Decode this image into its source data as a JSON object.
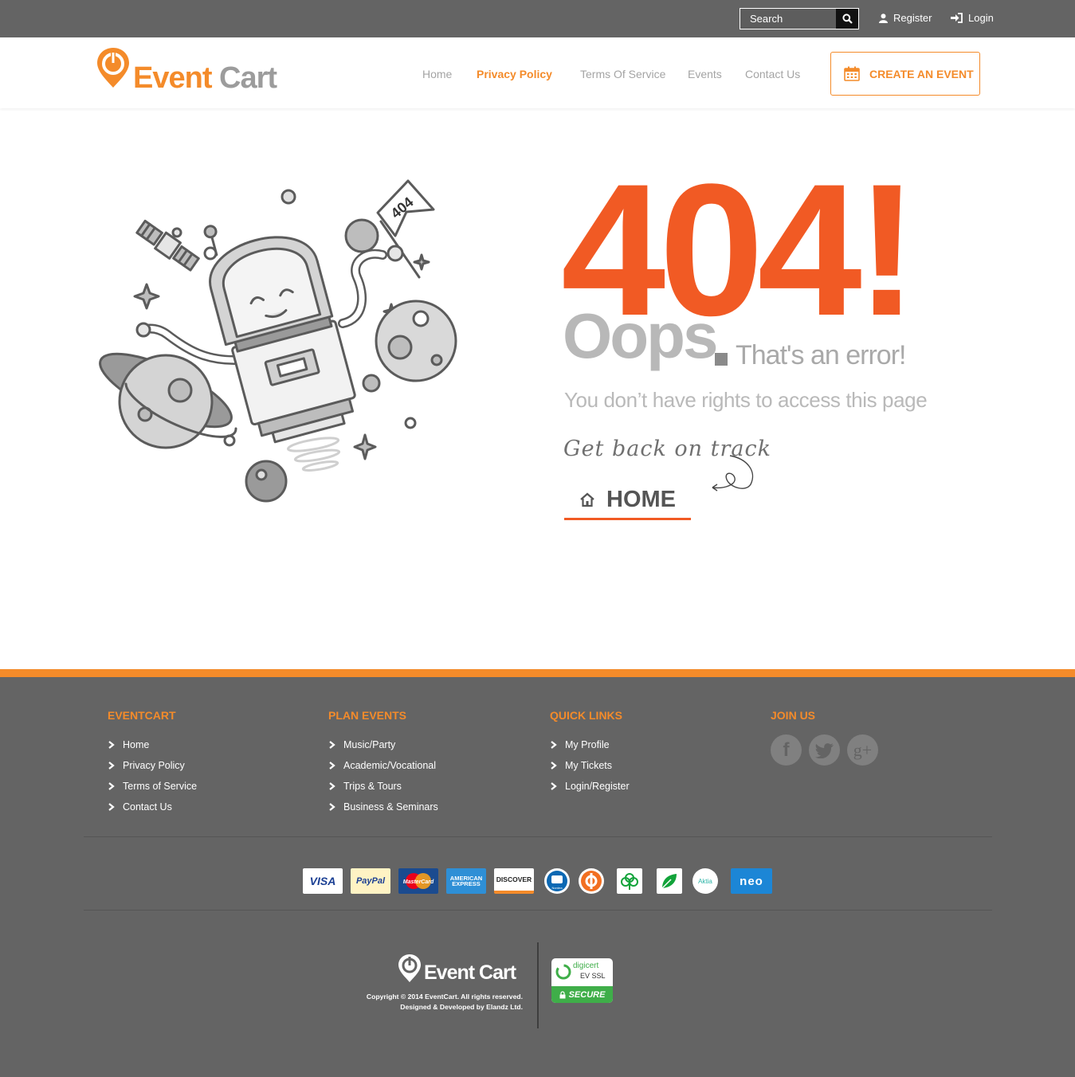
{
  "topbar": {
    "search_placeholder": "Search",
    "register": "Register",
    "login": "Login"
  },
  "brand": {
    "name_part1": "Event",
    "name_part2": "Cart"
  },
  "nav": {
    "items": [
      {
        "label": "Home"
      },
      {
        "label": "Privacy Policy"
      },
      {
        "label": "Terms Of Service"
      },
      {
        "label": "Events"
      },
      {
        "label": "Contact Us"
      }
    ],
    "active": "Privacy Policy",
    "cta": "CREATE AN EVENT"
  },
  "error": {
    "illustration_flag": "404",
    "code": "404!",
    "oops": "Oops",
    "subtitle": "That's an error!",
    "message": "You don’t have rights to access this page",
    "track": "Get back on track",
    "home_button": "HOME"
  },
  "footer": {
    "columns": [
      {
        "title": "EVENTCART",
        "items": [
          "Home",
          "Privacy Policy",
          "Terms of Service",
          "Contact Us"
        ]
      },
      {
        "title": "PLAN EVENTS",
        "items": [
          "Music/Party",
          "Academic/Vocational",
          "Trips & Tours",
          "Business & Seminars"
        ]
      },
      {
        "title": "QUICK LINKS",
        "items": [
          "My Profile",
          "My Tickets",
          "Login/Register"
        ]
      },
      {
        "title": "JOIN US",
        "items": []
      }
    ],
    "social": [
      "f",
      "t",
      "g+"
    ],
    "payments": {
      "visa": "VISA",
      "paypal": "PayPal",
      "mastercard": "MasterCard",
      "amex_line1": "AMERICAN",
      "amex_line2": "EXPRESS",
      "discover": "DISCOVER",
      "nordea": "Nordea",
      "aktia": "Aktia",
      "neo": "neo"
    },
    "copyright": "Copyright © 2014 EventCart. All rights reserved.",
    "designed": "Designed & Developed by Elandz Ltd.",
    "digicert": {
      "brand": "digicert",
      "ssl": "EV SSL",
      "secure": "SECURE"
    }
  },
  "colors": {
    "accent": "#f48b2a",
    "error_orange": "#f15a24",
    "footer_bg": "#646464"
  }
}
